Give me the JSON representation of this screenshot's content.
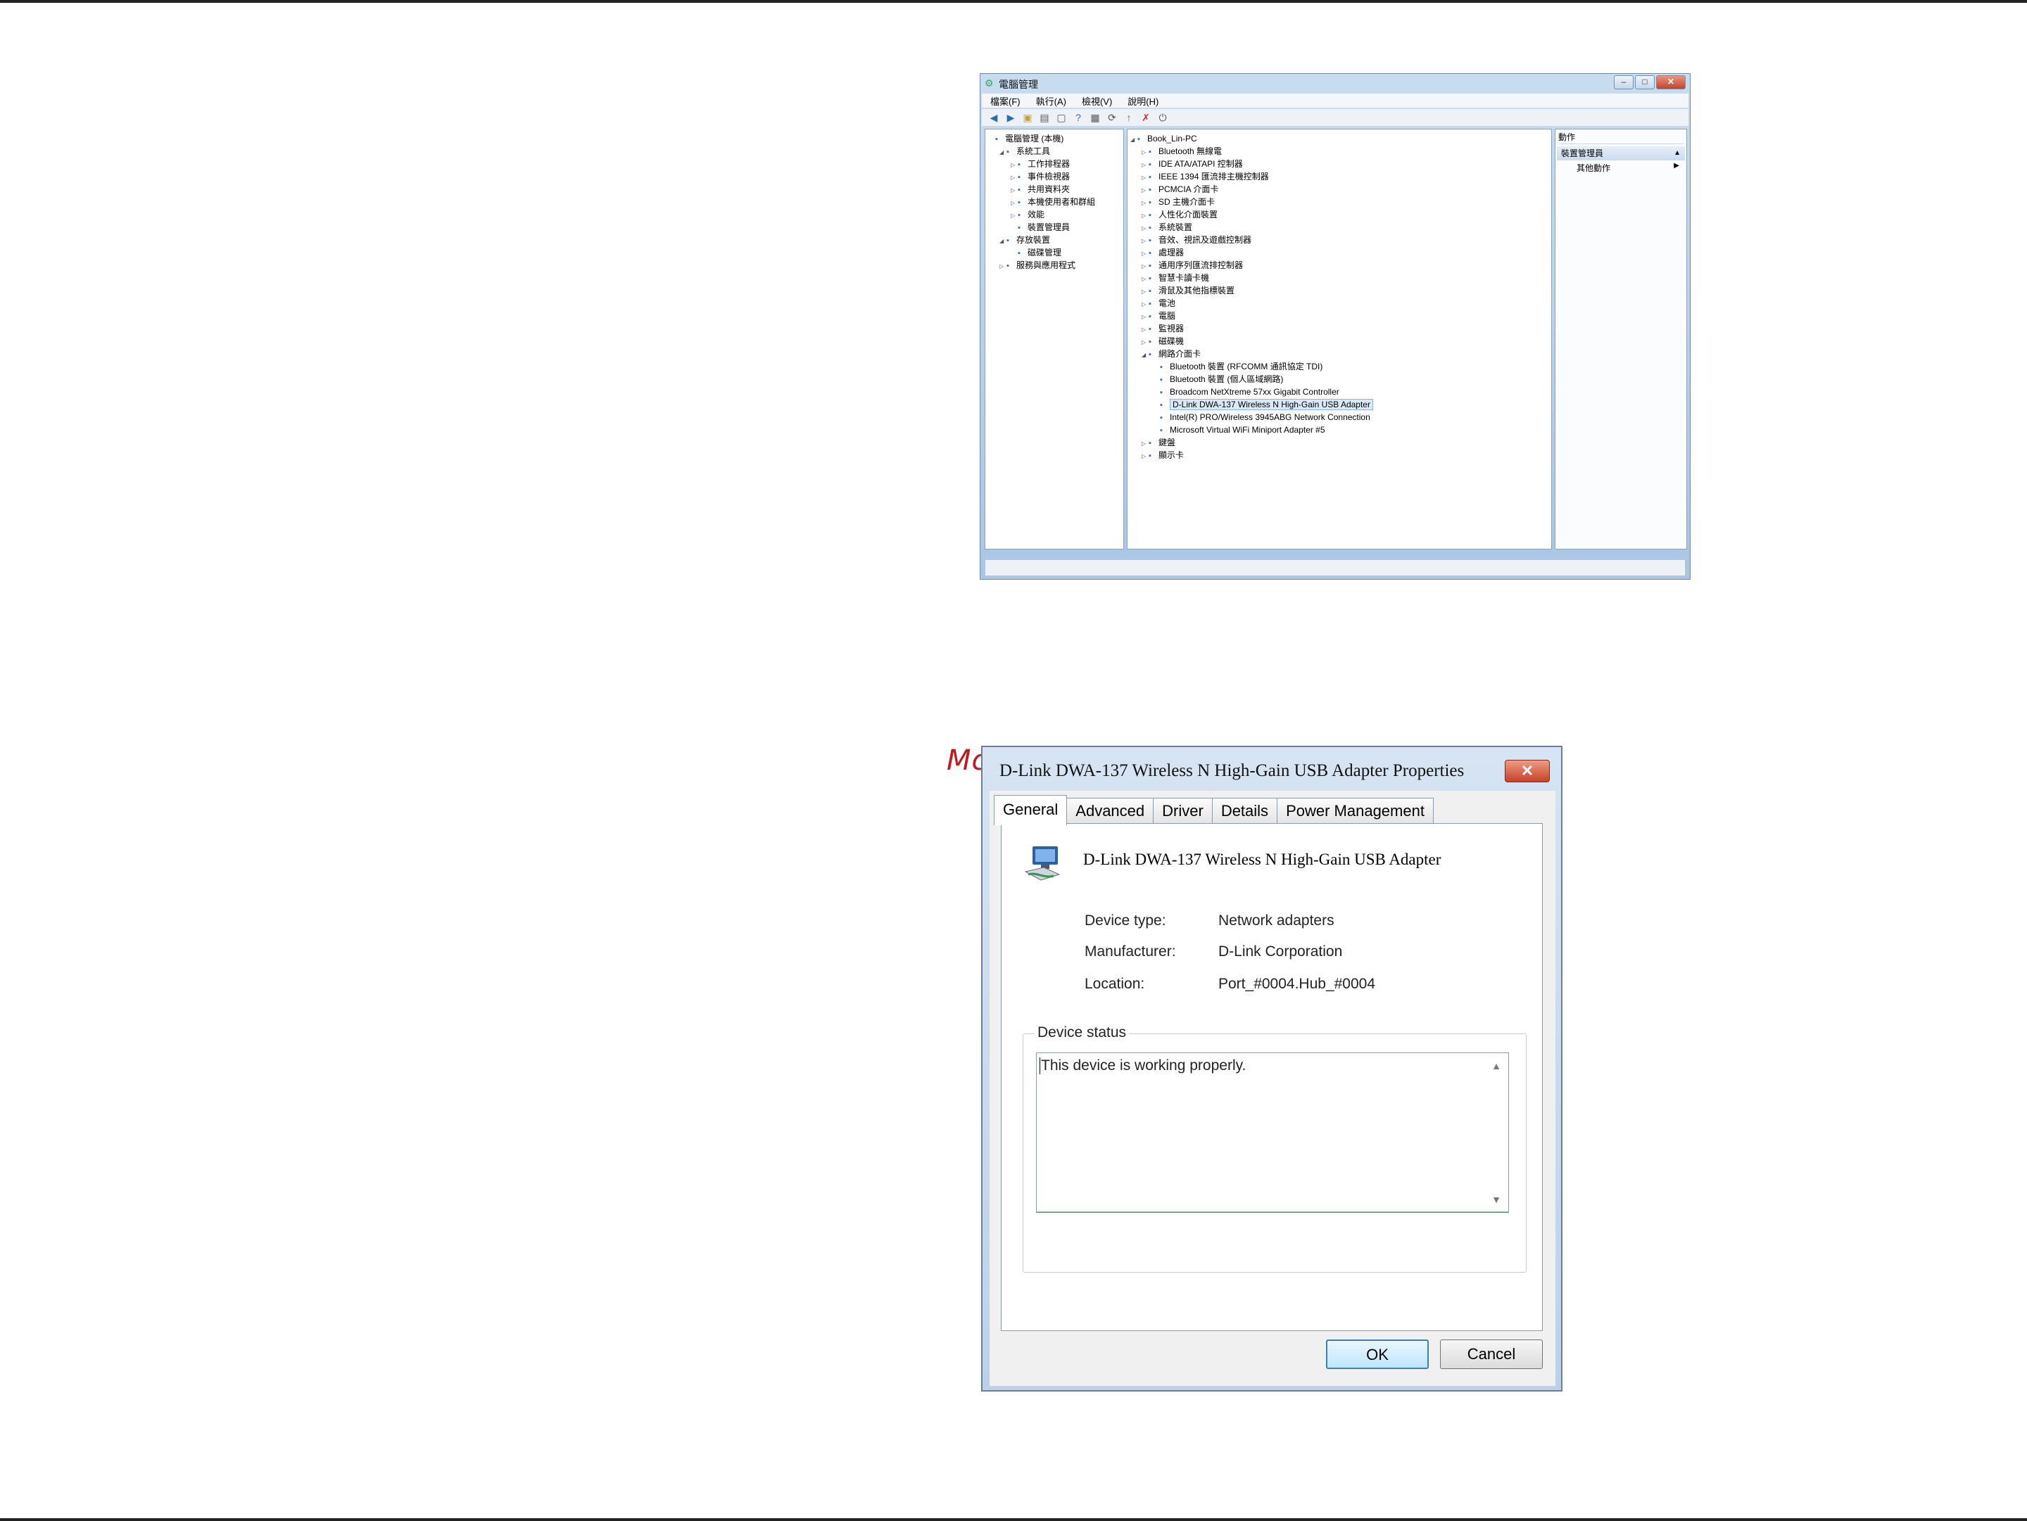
{
  "computer_management": {
    "title": "電腦管理",
    "menu": [
      "檔案(F)",
      "執行(A)",
      "檢視(V)",
      "說明(H)"
    ],
    "left_tree": [
      {
        "label": "電腦管理 (本機)",
        "icon": "computer-icon",
        "level": 0,
        "arrow": ""
      },
      {
        "label": "系統工具",
        "icon": "tools-icon",
        "level": 1,
        "arrow": "◢"
      },
      {
        "label": "工作排程器",
        "icon": "clock-icon",
        "level": 2,
        "arrow": "▷"
      },
      {
        "label": "事件檢視器",
        "icon": "event-icon",
        "level": 2,
        "arrow": "▷"
      },
      {
        "label": "共用資料夾",
        "icon": "folder-icon",
        "level": 2,
        "arrow": "▷"
      },
      {
        "label": "本機使用者和群組",
        "icon": "users-icon",
        "level": 2,
        "arrow": "▷"
      },
      {
        "label": "效能",
        "icon": "performance-icon",
        "level": 2,
        "arrow": "▷"
      },
      {
        "label": "裝置管理員",
        "icon": "device-manager-icon",
        "level": 2,
        "arrow": ""
      },
      {
        "label": "存放裝置",
        "icon": "storage-icon",
        "level": 1,
        "arrow": "◢"
      },
      {
        "label": "磁碟管理",
        "icon": "disk-icon",
        "level": 2,
        "arrow": ""
      },
      {
        "label": "服務與應用程式",
        "icon": "services-icon",
        "level": 1,
        "arrow": "▷"
      }
    ],
    "device_tree": [
      {
        "label": "Book_Lin-PC",
        "icon": "computer-icon",
        "level": 0,
        "arrow": "◢"
      },
      {
        "label": "Bluetooth 無線電",
        "icon": "bluetooth-icon",
        "level": 1,
        "arrow": "▷"
      },
      {
        "label": "IDE ATA/ATAPI 控制器",
        "icon": "ide-icon",
        "level": 1,
        "arrow": "▷"
      },
      {
        "label": "IEEE 1394 匯流排主機控制器",
        "icon": "firewire-icon",
        "level": 1,
        "arrow": "▷"
      },
      {
        "label": "PCMCIA 介面卡",
        "icon": "pcmcia-icon",
        "level": 1,
        "arrow": "▷"
      },
      {
        "label": "SD 主機介面卡",
        "icon": "sd-icon",
        "level": 1,
        "arrow": "▷"
      },
      {
        "label": "人性化介面裝置",
        "icon": "hid-icon",
        "level": 1,
        "arrow": "▷"
      },
      {
        "label": "系統裝置",
        "icon": "system-icon",
        "level": 1,
        "arrow": "▷"
      },
      {
        "label": "音效、視訊及遊戲控制器",
        "icon": "sound-icon",
        "level": 1,
        "arrow": "▷"
      },
      {
        "label": "處理器",
        "icon": "cpu-icon",
        "level": 1,
        "arrow": "▷"
      },
      {
        "label": "通用序列匯流排控制器",
        "icon": "usb-icon",
        "level": 1,
        "arrow": "▷"
      },
      {
        "label": "智慧卡讀卡機",
        "icon": "smartcard-icon",
        "level": 1,
        "arrow": "▷"
      },
      {
        "label": "滑鼠及其他指標裝置",
        "icon": "mouse-icon",
        "level": 1,
        "arrow": "▷"
      },
      {
        "label": "電池",
        "icon": "battery-icon",
        "level": 1,
        "arrow": "▷"
      },
      {
        "label": "電腦",
        "icon": "pc-icon",
        "level": 1,
        "arrow": "▷"
      },
      {
        "label": "監視器",
        "icon": "monitor-icon",
        "level": 1,
        "arrow": "▷"
      },
      {
        "label": "磁碟機",
        "icon": "drive-icon",
        "level": 1,
        "arrow": "▷"
      },
      {
        "label": "網路介面卡",
        "icon": "network-icon",
        "level": 1,
        "arrow": "◢"
      },
      {
        "label": "Bluetooth 裝置 (RFCOMM 通訊協定 TDI)",
        "icon": "network-adapter-icon",
        "level": 2,
        "arrow": ""
      },
      {
        "label": "Bluetooth 裝置 (個人區域網路)",
        "icon": "network-adapter-icon",
        "level": 2,
        "arrow": ""
      },
      {
        "label": "Broadcom NetXtreme 57xx Gigabit Controller",
        "icon": "network-adapter-icon",
        "level": 2,
        "arrow": ""
      },
      {
        "label": "D-Link DWA-137 Wireless N High-Gain USB Adapter",
        "icon": "network-adapter-icon",
        "level": 2,
        "arrow": "",
        "selected": true
      },
      {
        "label": "Intel(R) PRO/Wireless 3945ABG Network Connection",
        "icon": "network-adapter-icon",
        "level": 2,
        "arrow": ""
      },
      {
        "label": "Microsoft Virtual WiFi Miniport Adapter #5",
        "icon": "network-adapter-icon",
        "level": 2,
        "arrow": ""
      },
      {
        "label": "鍵盤",
        "icon": "keyboard-icon",
        "level": 1,
        "arrow": "▷"
      },
      {
        "label": "顯示卡",
        "icon": "display-icon",
        "level": 1,
        "arrow": "▷"
      }
    ],
    "actions": {
      "header": "動作",
      "section": "裝置管理員",
      "more": "其他動作"
    }
  },
  "watermark": "McGrp.Ru",
  "dialog": {
    "title": "D-Link DWA-137 Wireless N High-Gain USB Adapter Properties",
    "close_glyph": "✕",
    "tabs": [
      "General",
      "Advanced",
      "Driver",
      "Details",
      "Power Management"
    ],
    "active_tab": "General",
    "device_name": "D-Link DWA-137 Wireless N High-Gain USB Adapter",
    "properties": [
      {
        "label": "Device type:",
        "value": "Network adapters"
      },
      {
        "label": "Manufacturer:",
        "value": "D-Link Corporation"
      },
      {
        "label": "Location:",
        "value": "Port_#0004.Hub_#0004"
      }
    ],
    "status_group_label": "Device status",
    "status_text": "This device is working properly.",
    "ok_label": "OK",
    "cancel_label": "Cancel"
  },
  "colors": {
    "watermark": "#c4171e",
    "ok_border": "#3c7fb1",
    "close_button": "#c84227"
  }
}
